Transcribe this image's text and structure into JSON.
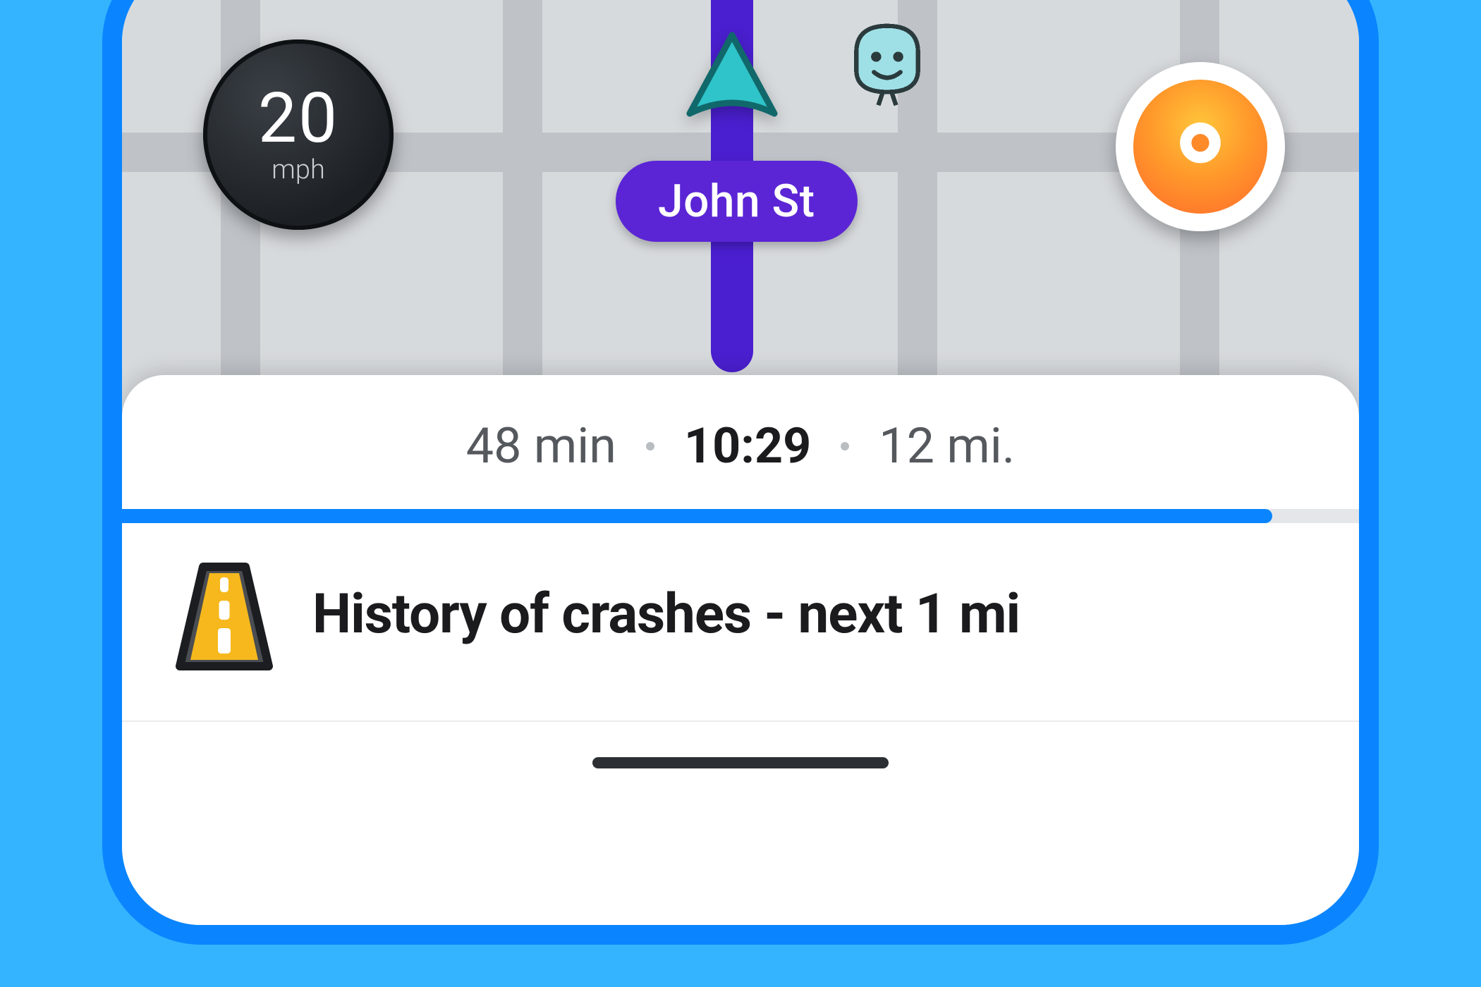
{
  "speed": {
    "value": "20",
    "unit": "mph"
  },
  "street": {
    "name": "John St"
  },
  "trip": {
    "duration": "48 min",
    "arrival": "10:29",
    "distance": "12 mi.",
    "progress_percent": 93
  },
  "alert": {
    "text": "History of crashes - next 1 mi"
  },
  "icons": {
    "arrow": "navigation-arrow-icon",
    "wazer": "wazer-icon",
    "recenter": "recenter-icon",
    "road": "road-hazard-icon"
  }
}
